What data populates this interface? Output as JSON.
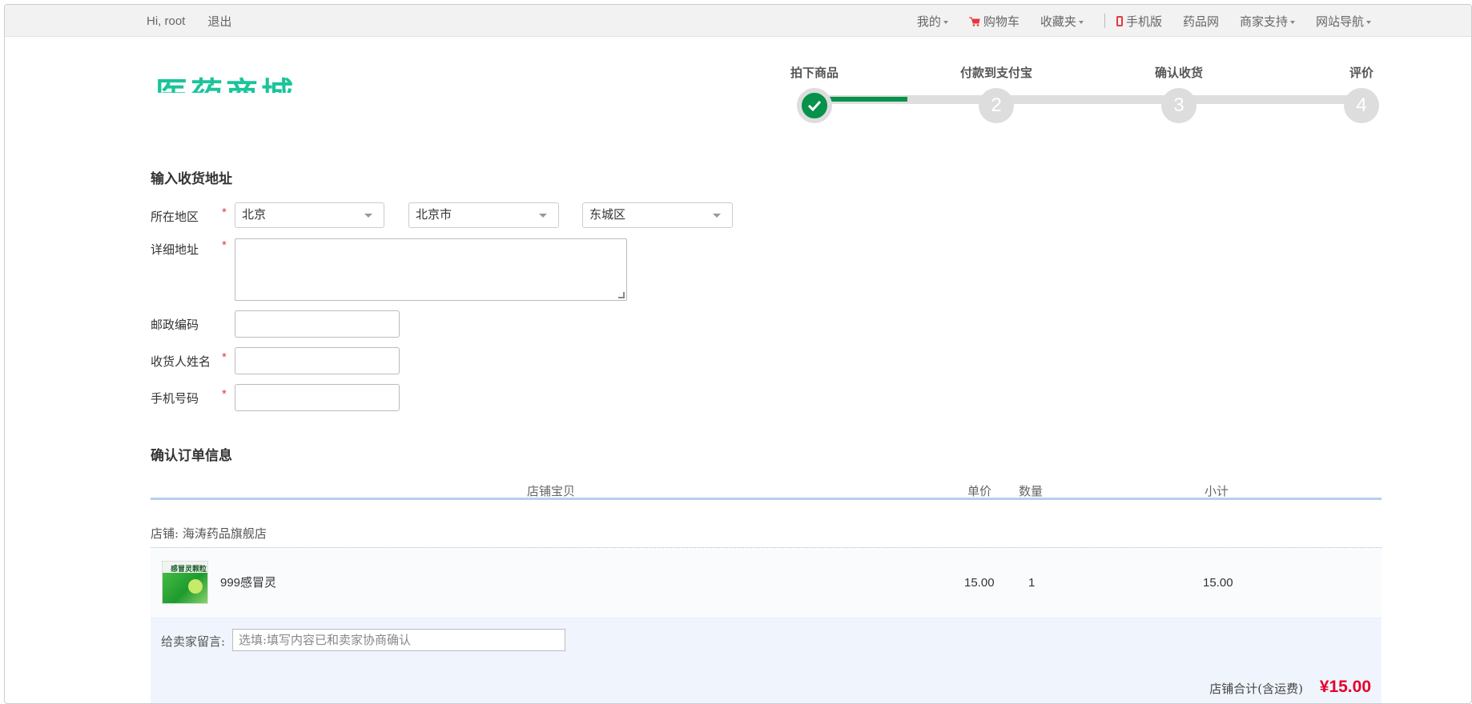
{
  "topbar": {
    "greeting": "Hi, root",
    "logout": "退出",
    "nav": {
      "mine": "我的",
      "cart": "购物车",
      "favorites": "收藏夹",
      "mobile": "手机版",
      "drug_site": "药品网",
      "merchant_support": "商家支持",
      "site_nav": "网站导航"
    }
  },
  "logo": {
    "text": "医药商城"
  },
  "steps": [
    {
      "label": "拍下商品",
      "number": "1",
      "done": true
    },
    {
      "label": "付款到支付宝",
      "number": "2",
      "done": false
    },
    {
      "label": "确认收货",
      "number": "3",
      "done": false
    },
    {
      "label": "评价",
      "number": "4",
      "done": false
    }
  ],
  "address": {
    "title": "输入收货地址",
    "region_label": "所在地区",
    "province": "北京",
    "city": "北京市",
    "district": "东城区",
    "detail_label": "详细地址",
    "zip_label": "邮政编码",
    "name_label": "收货人姓名",
    "phone_label": "手机号码",
    "required_mark": "*"
  },
  "order": {
    "title": "确认订单信息",
    "columns": {
      "item": "店铺宝贝",
      "price": "单价",
      "qty": "数量",
      "subtotal": "小计"
    },
    "shop_label": "店铺: 海涛药品旗舰店",
    "items": [
      {
        "name": "999感冒灵",
        "price": "15.00",
        "qty": "1",
        "subtotal": "15.00",
        "thumb_text": "感冒灵颗粒"
      }
    ],
    "message_label": "给卖家留言:",
    "message_placeholder": "选填:填写内容已和卖家协商确认",
    "total_label": "店铺合计(含运费)",
    "total_value": "¥15.00"
  },
  "colors": {
    "accent_green": "#06924a",
    "logo_green": "#1bc49a",
    "price_red": "#e4002b"
  }
}
